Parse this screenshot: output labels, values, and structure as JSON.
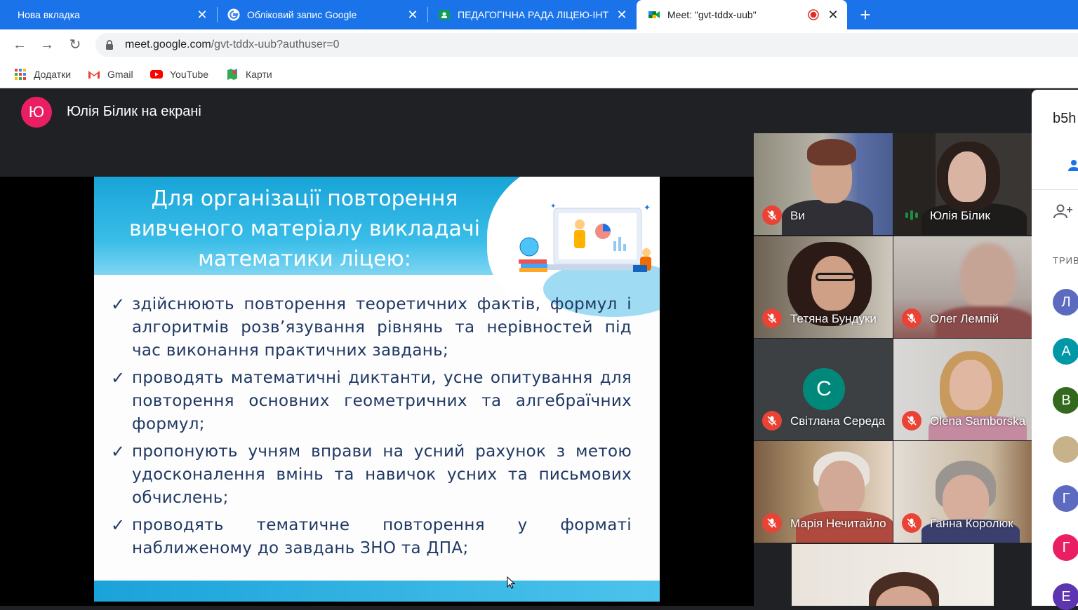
{
  "browser": {
    "tabs": [
      {
        "title": "Нова вкладка"
      },
      {
        "title": "Обліковий запис Google"
      },
      {
        "title": "ПЕДАГОГІЧНА РАДА ЛІЦЕЮ-ІНТ"
      },
      {
        "title": "Meet: \"gvt-tddx-uub\""
      }
    ],
    "url_host": "meet.google.com",
    "url_path": "/gvt-tddx-uub?authuser=0",
    "bookmarks": [
      {
        "label": "Додатки",
        "icon": "apps-grid-icon"
      },
      {
        "label": "Gmail",
        "icon": "gmail-icon"
      },
      {
        "label": "YouTube",
        "icon": "youtube-icon"
      },
      {
        "label": "Карти",
        "icon": "maps-icon"
      }
    ]
  },
  "meet": {
    "presenter_initial": "Ю",
    "presenter_title": "Юлія Білик на екрані",
    "slide": {
      "title": "Для організації повторення вивченого матеріалу викладачі математики ліцею:",
      "items": [
        "здійснюють повторення теоретичних фактів, формул і алгоритмів розв’язування рівнянь та нерівностей під час виконання практичних завдань;",
        "проводять математичні диктанти, усне опитування для повторення основних геометричних та алгебраїчних формул;",
        "пропонують учням вправи на усний рахунок з метою удосконалення вмінь та навичок усних та письмових обчислень;",
        "проводять тематичне повторення у форматі наближеному до завдань ЗНО та ДПА;"
      ]
    },
    "participants": [
      {
        "name": "Ви",
        "muted": true
      },
      {
        "name": "Юлія Білик",
        "muted": false
      },
      {
        "name": "Тетяна Бундуки",
        "muted": true
      },
      {
        "name": "Олег Лемпій",
        "muted": true
      },
      {
        "name": "Світлана Середа",
        "muted": true,
        "initial": "С"
      },
      {
        "name": "Olena Samborska",
        "muted": true
      },
      {
        "name": "Марія Нечитайло",
        "muted": true
      },
      {
        "name": "Ганна Королюк",
        "muted": true
      }
    ]
  },
  "panel": {
    "meeting_code": "b5h",
    "section_label": "ТРИВ",
    "avatars": [
      {
        "initial": "Л",
        "color": "#5c6bc0"
      },
      {
        "initial": "А",
        "color": "#0097a7"
      },
      {
        "initial": "В",
        "color": "#33691e"
      },
      {
        "initial": "",
        "color": "#c7b28a"
      },
      {
        "initial": "Г",
        "color": "#5c6bc0"
      },
      {
        "initial": "Г",
        "color": "#e91e63"
      },
      {
        "initial": "Е",
        "color": "#5e35b1"
      }
    ]
  },
  "colors": {
    "tabbar": "#1a73e8",
    "meet_bg": "#202124",
    "mic_muted": "#ea4335",
    "slide_text": "#1f3864"
  }
}
